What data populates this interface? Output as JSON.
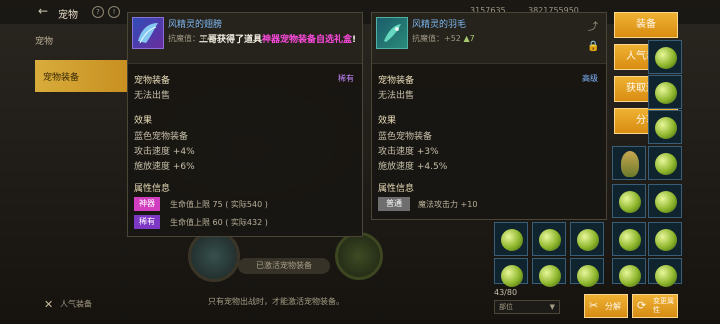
{
  "top": {
    "back_icon": "←",
    "title": "宠物",
    "currency_a": "3157635",
    "currency_b": "3821755950"
  },
  "menu": {
    "top_item": "宠物",
    "active_item": "宠物装备",
    "favorite_label": "人气装备"
  },
  "center": {
    "activated_label": "已激活宠物装备",
    "hint": "只有宠物出战时，才能激活宠物装备。"
  },
  "broadcast": {
    "prefix": "二哥获得了道具",
    "highlight": "神器宠物装备自选礼盒",
    "suffix": "!"
  },
  "left_panel": {
    "name": "风精灵的翅膀",
    "enchant_label": "抗魔值：",
    "enchant_value": "+45",
    "section_type": "宠物装备",
    "rarity": "稀有",
    "trade": "无法出售",
    "effect_title": "效果",
    "effects": [
      "蓝色宠物装备",
      "攻击速度 +4%",
      "施放速度 +6%"
    ],
    "attr_title": "属性信息",
    "attrs": [
      {
        "tag": "神器",
        "text": "生命值上限 75 ( 实际540 )",
        "color": "#d13fc0"
      },
      {
        "tag": "稀有",
        "text": "生命值上限 60 ( 实际432 )",
        "color": "#7e39c4"
      }
    ]
  },
  "right_panel": {
    "name": "风精灵的羽毛",
    "enchant_label": "抗魔值：",
    "enchant_value": "+52",
    "enchant_delta": "▲7",
    "section_type": "宠物装备",
    "rarity": "高级",
    "trade": "无法出售",
    "effect_title": "效果",
    "effects": [
      "蓝色宠物装备",
      "攻击速度 +3%",
      "施放速度 +4.5%"
    ],
    "attr_title": "属性信息",
    "attrs": [
      {
        "tag": "普通",
        "text": "魔法攻击力 +10",
        "color": "#6e6e6e"
      }
    ]
  },
  "actions": [
    "装备",
    "人气装备",
    "获取途径",
    "分享"
  ],
  "inventory": {
    "count": "43/80",
    "filter": "部位",
    "decompose": "分解",
    "transfer": "变更属性"
  }
}
